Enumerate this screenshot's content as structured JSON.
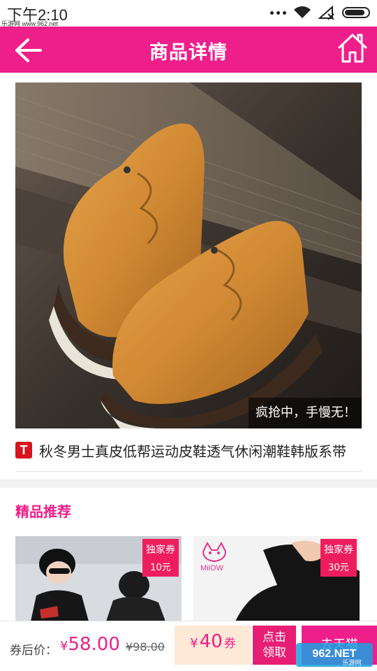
{
  "status_bar": {
    "time": "下午2:10",
    "watermark": "乐游网 www.962.net"
  },
  "header": {
    "title": "商品详情",
    "back_icon": "back-arrow-icon",
    "home_icon": "home-icon"
  },
  "product": {
    "promo_text": "疯抢中，手慢无！",
    "badge": "T",
    "title": "秋冬男士真皮低帮运动皮鞋透气休闲潮鞋韩版系带"
  },
  "recommend": {
    "title": "精品推荐",
    "items": [
      {
        "coupon_label": "独家券",
        "coupon_value": "10元"
      },
      {
        "coupon_label": "独家券",
        "coupon_value": "30元",
        "brand": "MiiOW"
      }
    ]
  },
  "bottom_bar": {
    "price_label": "券后价：",
    "price_symbol": "¥",
    "price_now": "58.00",
    "price_old": "¥98.00",
    "coupon_symbol": "¥",
    "coupon_amount": "40",
    "coupon_unit": "券",
    "claim_line1": "点击",
    "claim_line2": "领取",
    "tmall_label": "去天猫"
  },
  "watermark": {
    "logo": "962.NET",
    "sub": "乐游网"
  },
  "colors": {
    "brand_pink": "#ee1e8a",
    "coupon_red": "#ee1e5e",
    "tmall_red": "#d7131f"
  }
}
